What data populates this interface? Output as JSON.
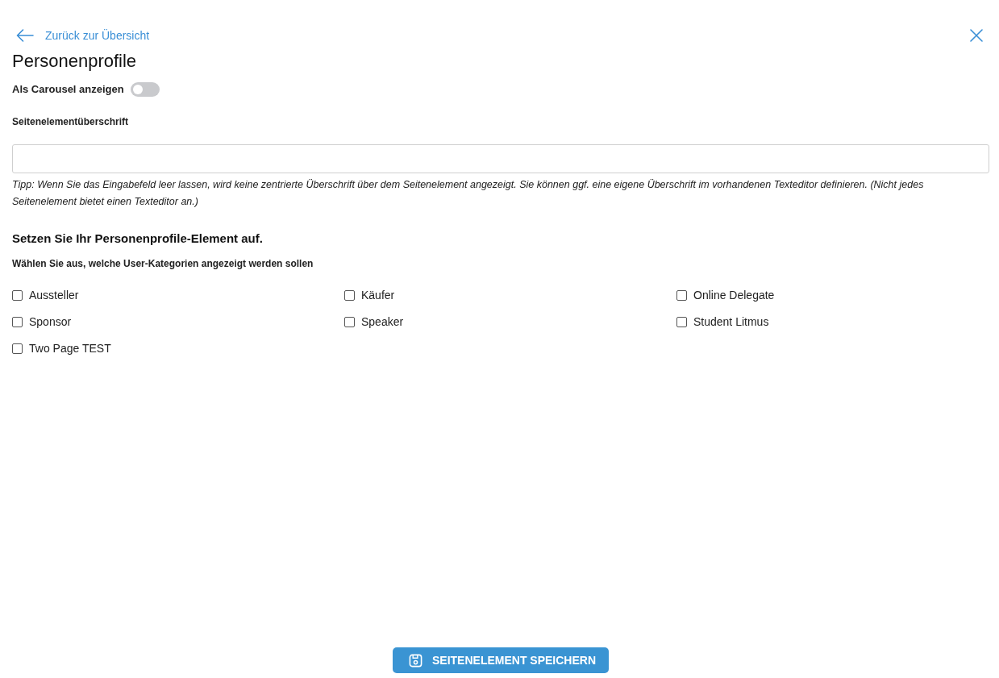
{
  "back_link": {
    "label": "Zurück zur Übersicht"
  },
  "title": "Personenprofile",
  "carousel_toggle": {
    "label": "Als Carousel anzeigen",
    "on": false
  },
  "heading_field": {
    "label": "Seitenelementüberschrift",
    "hint": "Tipp: Wenn Sie das Eingabefeld leer lassen, wird keine zentrierte Überschrift über dem Seitenelement angezeigt. Sie können ggf. eine eigene Überschrift im vorhandenen Texteditor definieren. (Nicht jedes Seitenelement bietet einen Texteditor an.)"
  },
  "setup": {
    "heading": "Setzen Sie Ihr Personenprofile-Element auf.",
    "subheading": "Wählen Sie aus, welche User-Kategorien angezeigt werden sollen",
    "categories": [
      {
        "label": "Aussteller",
        "checked": false
      },
      {
        "label": "Käufer",
        "checked": false
      },
      {
        "label": "Online Delegate",
        "checked": false
      },
      {
        "label": "Sponsor",
        "checked": false
      },
      {
        "label": "Speaker",
        "checked": false
      },
      {
        "label": "Student Litmus",
        "checked": false
      },
      {
        "label": "Two Page TEST",
        "checked": false
      }
    ]
  },
  "save_button": {
    "label": "SEITENELEMENT SPEICHERN"
  }
}
